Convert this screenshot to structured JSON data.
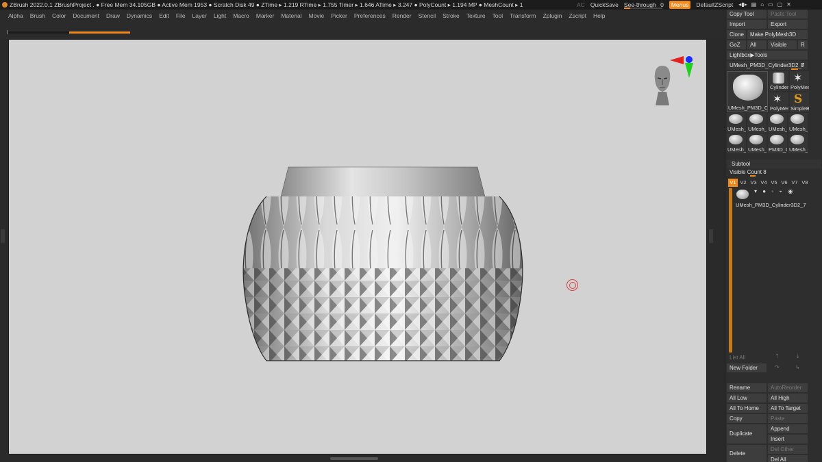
{
  "titlebar": {
    "status": "ZBrush 2022.0.1    ZBrushProject   . ● Free Mem 34.105GB ● Active Mem 1953 ● Scratch Disk 49 ●  ZTime ▸ 1.219 RTime ▸ 1.755 Timer ▸ 1.646 ATime ▸ 3.247 ● PolyCount ▸ 1.194 MP  ● MeshCount ▸ 1",
    "ac": "AC",
    "quicksave": "QuickSave",
    "see_through_label": "See-through",
    "see_through_value": "0",
    "see_through_fill": 0.05,
    "menus": "Menus",
    "default_zscript": "DefaultZScript"
  },
  "menubar": [
    "Alpha",
    "Brush",
    "Color",
    "Document",
    "Draw",
    "Dynamics",
    "Edit",
    "File",
    "Layer",
    "Light",
    "Macro",
    "Marker",
    "Material",
    "Movie",
    "Picker",
    "Preferences",
    "Render",
    "Stencil",
    "Stroke",
    "Texture",
    "Tool",
    "Transform",
    "Zplugin",
    "Zscript",
    "Help"
  ],
  "progress": 0.5,
  "tool": {
    "copy_tool": "Copy Tool",
    "paste_tool": "Paste Tool",
    "import": "Import",
    "export": "Export",
    "clone": "Clone",
    "make_polymesh": "Make PolyMesh3D",
    "goz": "GoZ",
    "all": "All",
    "visible": "Visible",
    "r": "R",
    "lightbox_tools": "Lightbox▶Tools",
    "current_tool": "UMesh_PM3D_Cylinder3D2_7",
    "current_tool_value": "8",
    "main_thumb_label": "UMesh_PM3D_C",
    "thumbs": [
      {
        "label": "Cylinder"
      },
      {
        "label": "PolyMes"
      },
      {
        "label": "PolyMes"
      },
      {
        "label": "SimpleB"
      },
      {
        "label": "UMesh_"
      },
      {
        "label": "UMesh_"
      },
      {
        "label": "UMesh_"
      },
      {
        "label": "UMesh_"
      },
      {
        "label": "UMesh_"
      },
      {
        "label": "UMesh_"
      },
      {
        "label": "PM3D_C"
      },
      {
        "label": "UMesh_"
      }
    ]
  },
  "subtool": {
    "title": "Subtool",
    "visible_count": "Visible Count 8",
    "tabs": [
      "V1",
      "V2",
      "V3",
      "V4",
      "V5",
      "V6",
      "V7",
      "V8"
    ],
    "item_name": "UMesh_PM3D_Cylinder3D2_7",
    "list_all": "List All",
    "new_folder": "New Folder",
    "rename": "Rename",
    "auto_reorder": "AutoReorder",
    "all_low": "All Low",
    "all_high": "All High",
    "all_to_home": "All To Home",
    "all_to_target": "All To Target",
    "copy": "Copy",
    "paste": "Paste",
    "append": "Append",
    "duplicate": "Duplicate",
    "insert": "Insert",
    "delete": "Delete",
    "del_other": "Del Other",
    "del_all": "Del All"
  },
  "colors": {
    "accent": "#f08a1c",
    "viewport_bg": "#d2d2d2",
    "panel_bg": "#2e2e2e",
    "button_bg": "#3d3d3d"
  }
}
